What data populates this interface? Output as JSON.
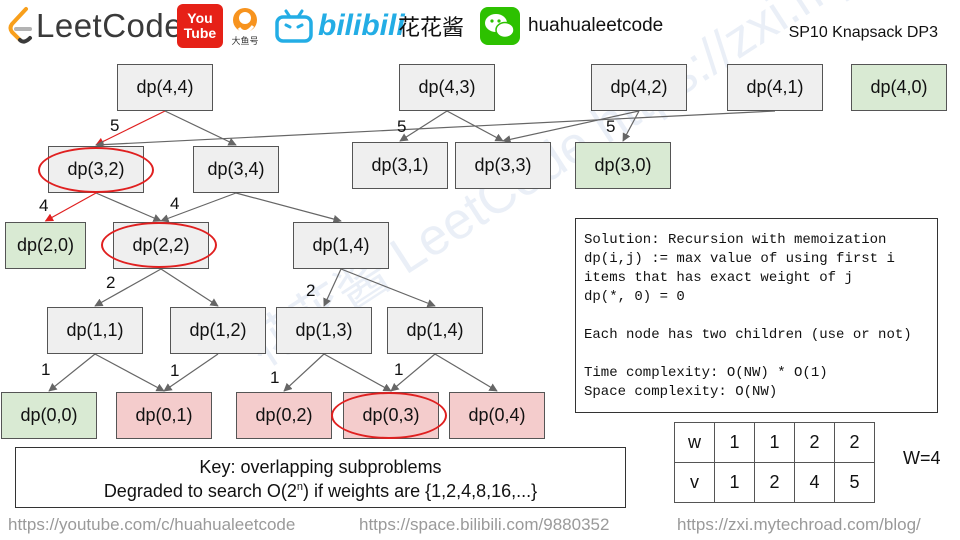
{
  "header": {
    "brand_name": "LeetCode",
    "youtube_top": "You",
    "youtube_bottom": "Tube",
    "dayu_label": "大鱼号",
    "bilibili_name": "bilibili",
    "channel_cn": "花花酱",
    "wechat_id": "huahualeetcode",
    "title": "SP10 Knapsack DP3"
  },
  "watermark": "花花酱 LeetCode https://zxi.mytechroad.com/blog/",
  "nodes": [
    {
      "id": "n44",
      "label": "dp(4,4)",
      "color": "gray"
    },
    {
      "id": "n43",
      "label": "dp(4,3)",
      "color": "gray"
    },
    {
      "id": "n42",
      "label": "dp(4,2)",
      "color": "gray"
    },
    {
      "id": "n41",
      "label": "dp(4,1)",
      "color": "gray"
    },
    {
      "id": "n40",
      "label": "dp(4,0)",
      "color": "green"
    },
    {
      "id": "n32",
      "label": "dp(3,2)",
      "color": "gray"
    },
    {
      "id": "n34",
      "label": "dp(3,4)",
      "color": "gray"
    },
    {
      "id": "n31",
      "label": "dp(3,1)",
      "color": "gray"
    },
    {
      "id": "n33",
      "label": "dp(3,3)",
      "color": "gray"
    },
    {
      "id": "n30",
      "label": "dp(3,0)",
      "color": "green"
    },
    {
      "id": "n20",
      "label": "dp(2,0)",
      "color": "green"
    },
    {
      "id": "n22",
      "label": "dp(2,2)",
      "color": "gray"
    },
    {
      "id": "n14a",
      "label": "dp(1,4)",
      "color": "gray"
    },
    {
      "id": "n11",
      "label": "dp(1,1)",
      "color": "gray"
    },
    {
      "id": "n12",
      "label": "dp(1,2)",
      "color": "gray"
    },
    {
      "id": "n13",
      "label": "dp(1,3)",
      "color": "gray"
    },
    {
      "id": "n14b",
      "label": "dp(1,4)",
      "color": "gray"
    },
    {
      "id": "n00",
      "label": "dp(0,0)",
      "color": "green"
    },
    {
      "id": "n01",
      "label": "dp(0,1)",
      "color": "pink"
    },
    {
      "id": "n02",
      "label": "dp(0,2)",
      "color": "pink"
    },
    {
      "id": "n03",
      "label": "dp(0,3)",
      "color": "pink"
    },
    {
      "id": "n04",
      "label": "dp(0,4)",
      "color": "pink"
    }
  ],
  "edges": [
    {
      "from": "n44",
      "to": "n32",
      "color": "red"
    },
    {
      "from": "n44",
      "to": "n34",
      "color": "gray"
    },
    {
      "from": "n41",
      "to": "n32",
      "color": "gray"
    },
    {
      "from": "n43",
      "to": "n31",
      "color": "gray"
    },
    {
      "from": "n43",
      "to": "n33",
      "color": "gray"
    },
    {
      "from": "n42",
      "to": "n33",
      "color": "gray"
    },
    {
      "from": "n42",
      "to": "n30",
      "color": "gray"
    },
    {
      "from": "n32",
      "to": "n20",
      "color": "red"
    },
    {
      "from": "n32",
      "to": "n22",
      "color": "gray"
    },
    {
      "from": "n34",
      "to": "n22",
      "color": "gray"
    },
    {
      "from": "n34",
      "to": "n14a",
      "color": "gray"
    },
    {
      "from": "n22",
      "to": "n11",
      "color": "gray"
    },
    {
      "from": "n22",
      "to": "n12",
      "color": "gray"
    },
    {
      "from": "n14a",
      "to": "n13",
      "color": "gray"
    },
    {
      "from": "n14a",
      "to": "n14b",
      "color": "gray"
    },
    {
      "from": "n11",
      "to": "n00",
      "color": "gray"
    },
    {
      "from": "n11",
      "to": "n01",
      "color": "gray"
    },
    {
      "from": "n12",
      "to": "n01",
      "color": "gray"
    },
    {
      "from": "n13",
      "to": "n02",
      "color": "gray"
    },
    {
      "from": "n13",
      "to": "n03",
      "color": "gray"
    },
    {
      "from": "n14b",
      "to": "n03",
      "color": "gray"
    },
    {
      "from": "n14b",
      "to": "n04",
      "color": "gray"
    }
  ],
  "edge_labels": [
    "5",
    "5",
    "5",
    "4",
    "4",
    "2",
    "2",
    "1",
    "1",
    "1",
    "1"
  ],
  "highlighted_nodes": [
    "n32",
    "n22",
    "n03"
  ],
  "solution_lines": [
    "Solution: Recursion with memoization",
    "dp(i,j) := max value of using first i",
    "items that has exact weight of j",
    "dp(*, 0) = 0",
    "",
    "Each node has two children (use or not)",
    "",
    "Time complexity: O(NW) * O(1)",
    "Space complexity: O(NW)"
  ],
  "key": {
    "line1": "Key: overlapping subproblems",
    "line2_pre": "Degraded to search O(2",
    "line2_sup": "n",
    "line2_post": ") if weights are {1,2,4,8,16,...}"
  },
  "items_table": {
    "w_label": "w",
    "weights": [
      "1",
      "1",
      "2",
      "2"
    ],
    "v_label": "v",
    "values": [
      "1",
      "2",
      "4",
      "5"
    ]
  },
  "capacity": "W=4",
  "footer": {
    "youtube_url": "https://youtube.com/c/huahualeetcode",
    "bilibili_url": "https://space.bilibili.com/9880352",
    "blog_url": "https://zxi.mytechroad.com/blog/"
  },
  "colors": {
    "node_gray": "#efefef",
    "node_green": "#d9ead3",
    "node_pink": "#f4cccc",
    "highlight_red": "#e02020",
    "edge_gray": "#666666"
  }
}
